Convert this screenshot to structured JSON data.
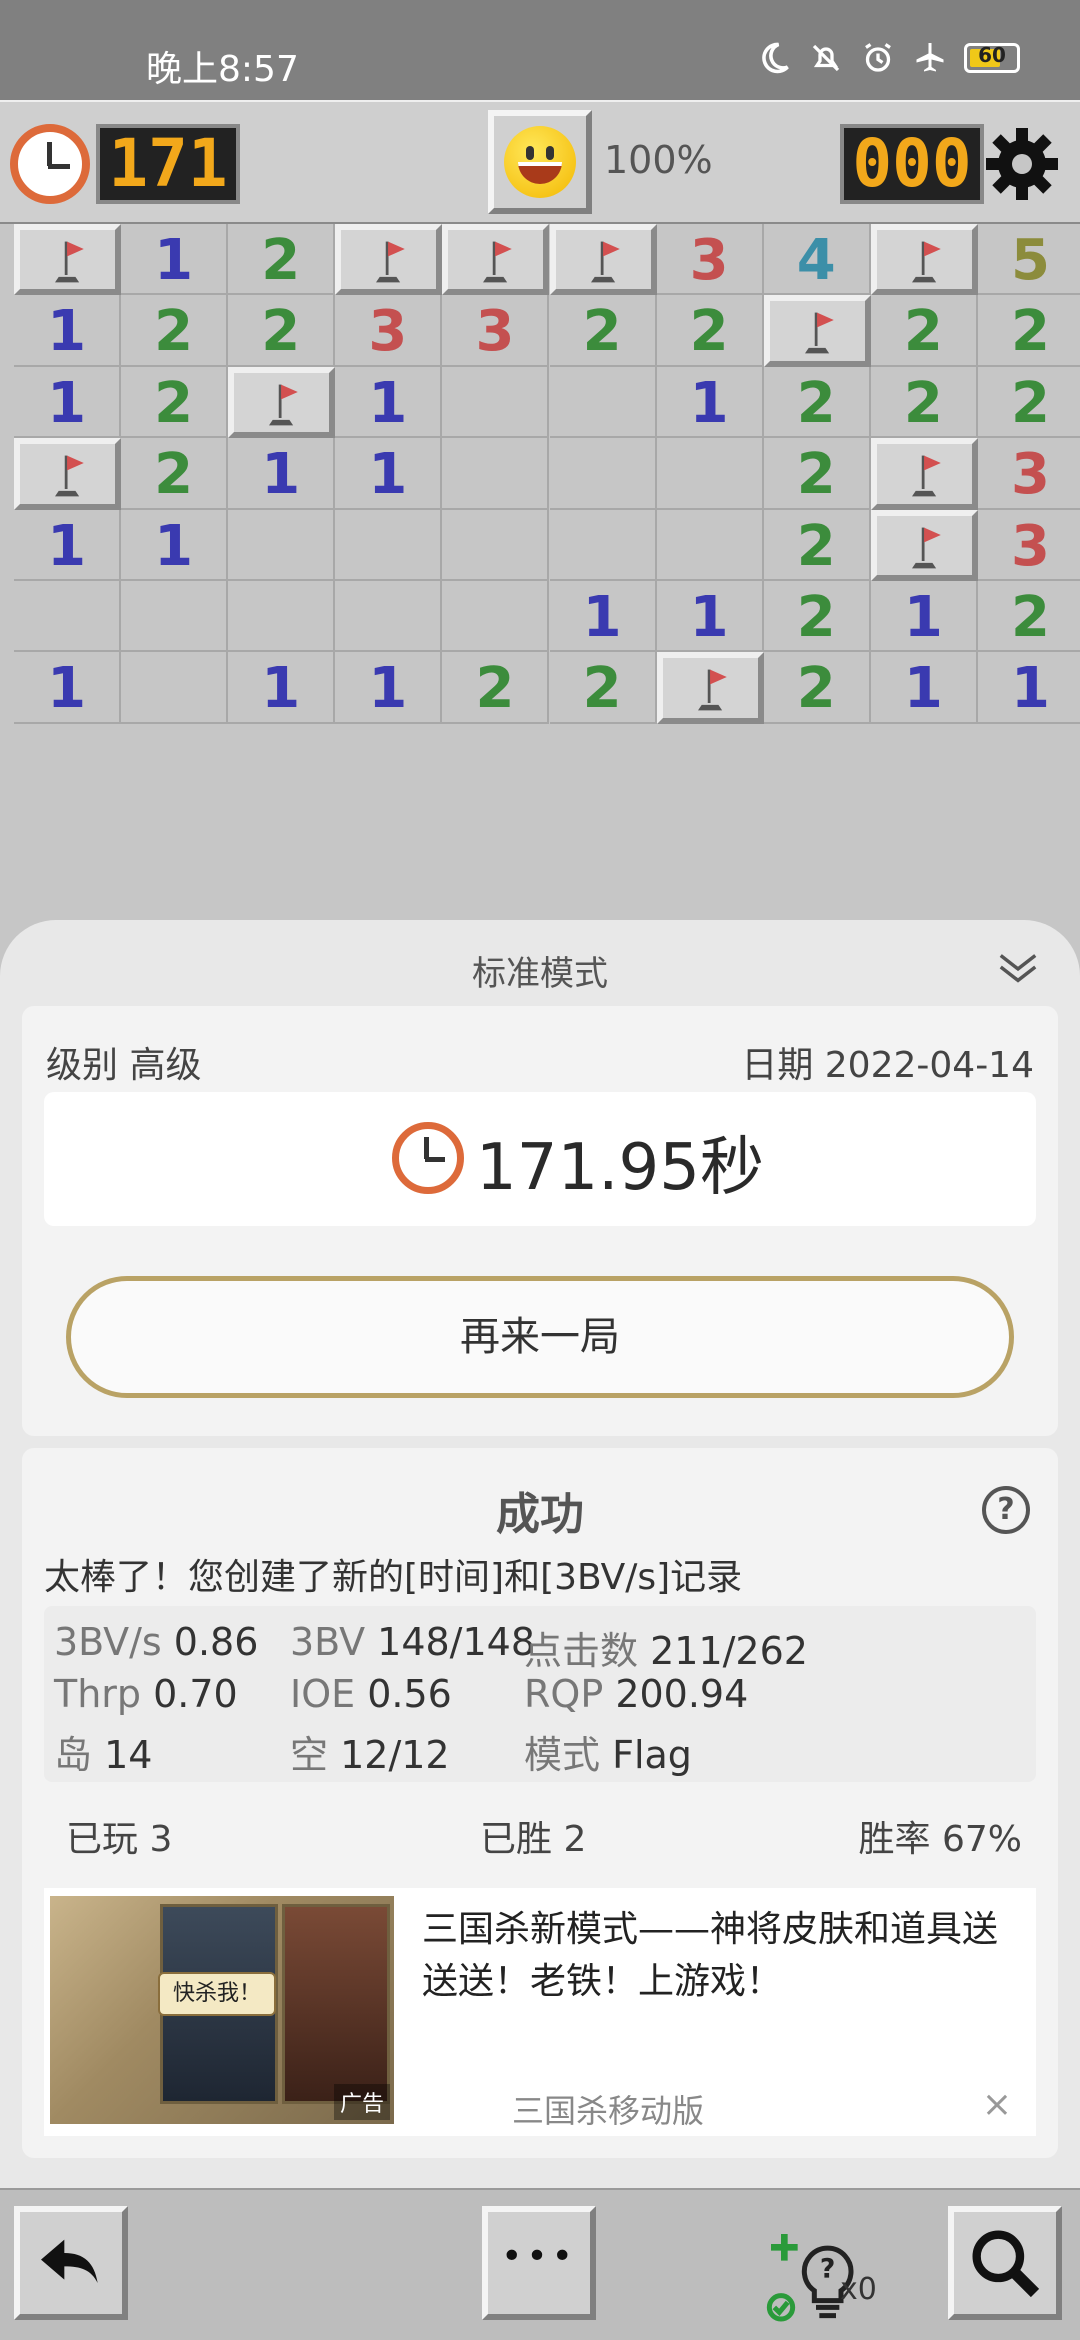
{
  "status_bar": {
    "time": "晚上8:57",
    "battery": "60"
  },
  "header": {
    "timer": "171",
    "percent": "100%",
    "mine_counter": "000"
  },
  "board": {
    "rows": [
      [
        "F",
        "1",
        "2",
        "F",
        "F",
        "F",
        "3",
        "4",
        "F",
        "5"
      ],
      [
        "1",
        "2",
        "2",
        "3",
        "3",
        "2",
        "2",
        "F",
        "2",
        "2"
      ],
      [
        "1",
        "2",
        "F",
        "1",
        "",
        "",
        "1",
        "2",
        "2",
        "2"
      ],
      [
        "F",
        "2",
        "1",
        "1",
        "",
        "",
        "",
        "2",
        "F",
        "3"
      ],
      [
        "1",
        "1",
        "",
        "",
        "",
        "",
        "",
        "2",
        "F",
        "3"
      ],
      [
        "",
        "",
        "",
        "",
        "",
        "1",
        "1",
        "2",
        "1",
        "2"
      ],
      [
        "1",
        "",
        "1",
        "1",
        "2",
        "2",
        "F",
        "2",
        "1",
        "1"
      ]
    ],
    "number_colors": {
      "1": "#3a3ab0",
      "2": "#3c8c3c",
      "3": "#c45050",
      "4": "#3c8fa8",
      "5": "#8c8c3c"
    }
  },
  "sheet": {
    "title": "标准模式",
    "level": "级别 高级",
    "date": "日期 2022-04-14",
    "time_value": "171.95秒",
    "again_label": "再来一局",
    "result_title": "成功",
    "record_text": "太棒了！您创建了新的[时间]和[3BV/s]记录",
    "stats": [
      {
        "key": "3BV/s",
        "value": "0.86"
      },
      {
        "key": "3BV",
        "value": "148/148"
      },
      {
        "key": "点击数",
        "value": "211/262"
      },
      {
        "key": "Thrp",
        "value": "0.70"
      },
      {
        "key": "IOE",
        "value": "0.56"
      },
      {
        "key": "RQP",
        "value": "200.94"
      },
      {
        "key": "岛",
        "value": "14"
      },
      {
        "key": "空",
        "value": "12/12"
      },
      {
        "key": "模式",
        "value": "Flag"
      }
    ],
    "played": "已玩 3",
    "won": "已胜 2",
    "win_rate": "胜率 67%",
    "ad": {
      "headline": "三国杀新模式——神将皮肤和道具送送送！老铁！上游戏！",
      "brand": "三国杀移动版",
      "tag": "广告",
      "card_text": "快杀我！",
      "close": "×"
    }
  },
  "toolbar": {
    "hint_count": "x0",
    "more": "•••"
  },
  "icons": [
    "clock-icon",
    "smiley-icon",
    "gear-icon",
    "flag-icon",
    "chevron-down-icon",
    "help-icon",
    "undo-icon",
    "more-icon",
    "hint-icon",
    "magnifier-icon",
    "close-icon"
  ]
}
